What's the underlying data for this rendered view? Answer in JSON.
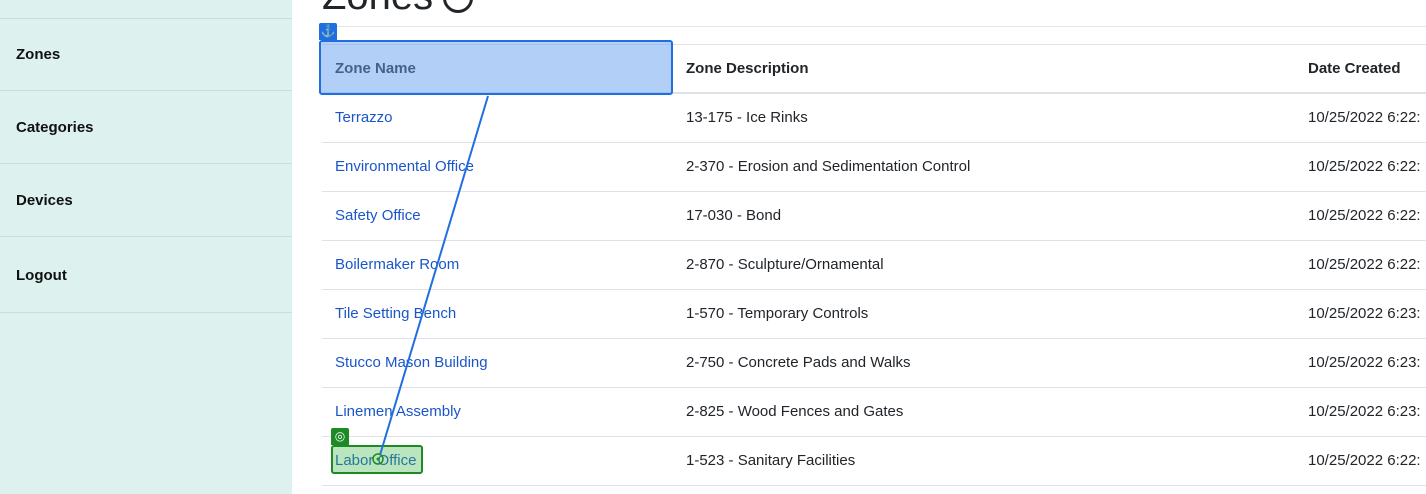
{
  "sidebar": {
    "items": [
      {
        "label": "Zones"
      },
      {
        "label": "Categories"
      },
      {
        "label": "Devices"
      },
      {
        "label": "Logout"
      }
    ]
  },
  "page": {
    "title": "Zones"
  },
  "table": {
    "headers": [
      "Zone Name",
      "Zone Description",
      "Date Created"
    ],
    "rows": [
      {
        "name": "Terrazzo",
        "description": "13-175 - Ice Rinks",
        "date": "10/25/2022 6:22:"
      },
      {
        "name": "Environmental Office",
        "description": "2-370 - Erosion and Sedimentation Control",
        "date": "10/25/2022 6:22:"
      },
      {
        "name": "Safety Office",
        "description": "17-030 - Bond",
        "date": "10/25/2022 6:22:"
      },
      {
        "name": "Boilermaker Room",
        "description": "2-870 - Sculpture/Ornamental",
        "date": "10/25/2022 6:22:"
      },
      {
        "name": "Tile Setting Bench",
        "description": "1-570 - Temporary Controls",
        "date": "10/25/2022 6:23:"
      },
      {
        "name": "Stucco Mason Building",
        "description": "2-750 - Concrete Pads and Walks",
        "date": "10/25/2022 6:23:"
      },
      {
        "name": "Linemen Assembly",
        "description": "2-825 - Wood Fences and Gates",
        "date": "10/25/2022 6:23:"
      },
      {
        "name": "Labor Office",
        "description": "1-523 - Sanitary Facilities",
        "date": "10/25/2022 6:22:"
      }
    ]
  },
  "overlay": {
    "source_icon": "anchor-icon",
    "target_icon": "target-icon",
    "source_color": "#1f6fe0",
    "target_color": "#1d8a24"
  }
}
